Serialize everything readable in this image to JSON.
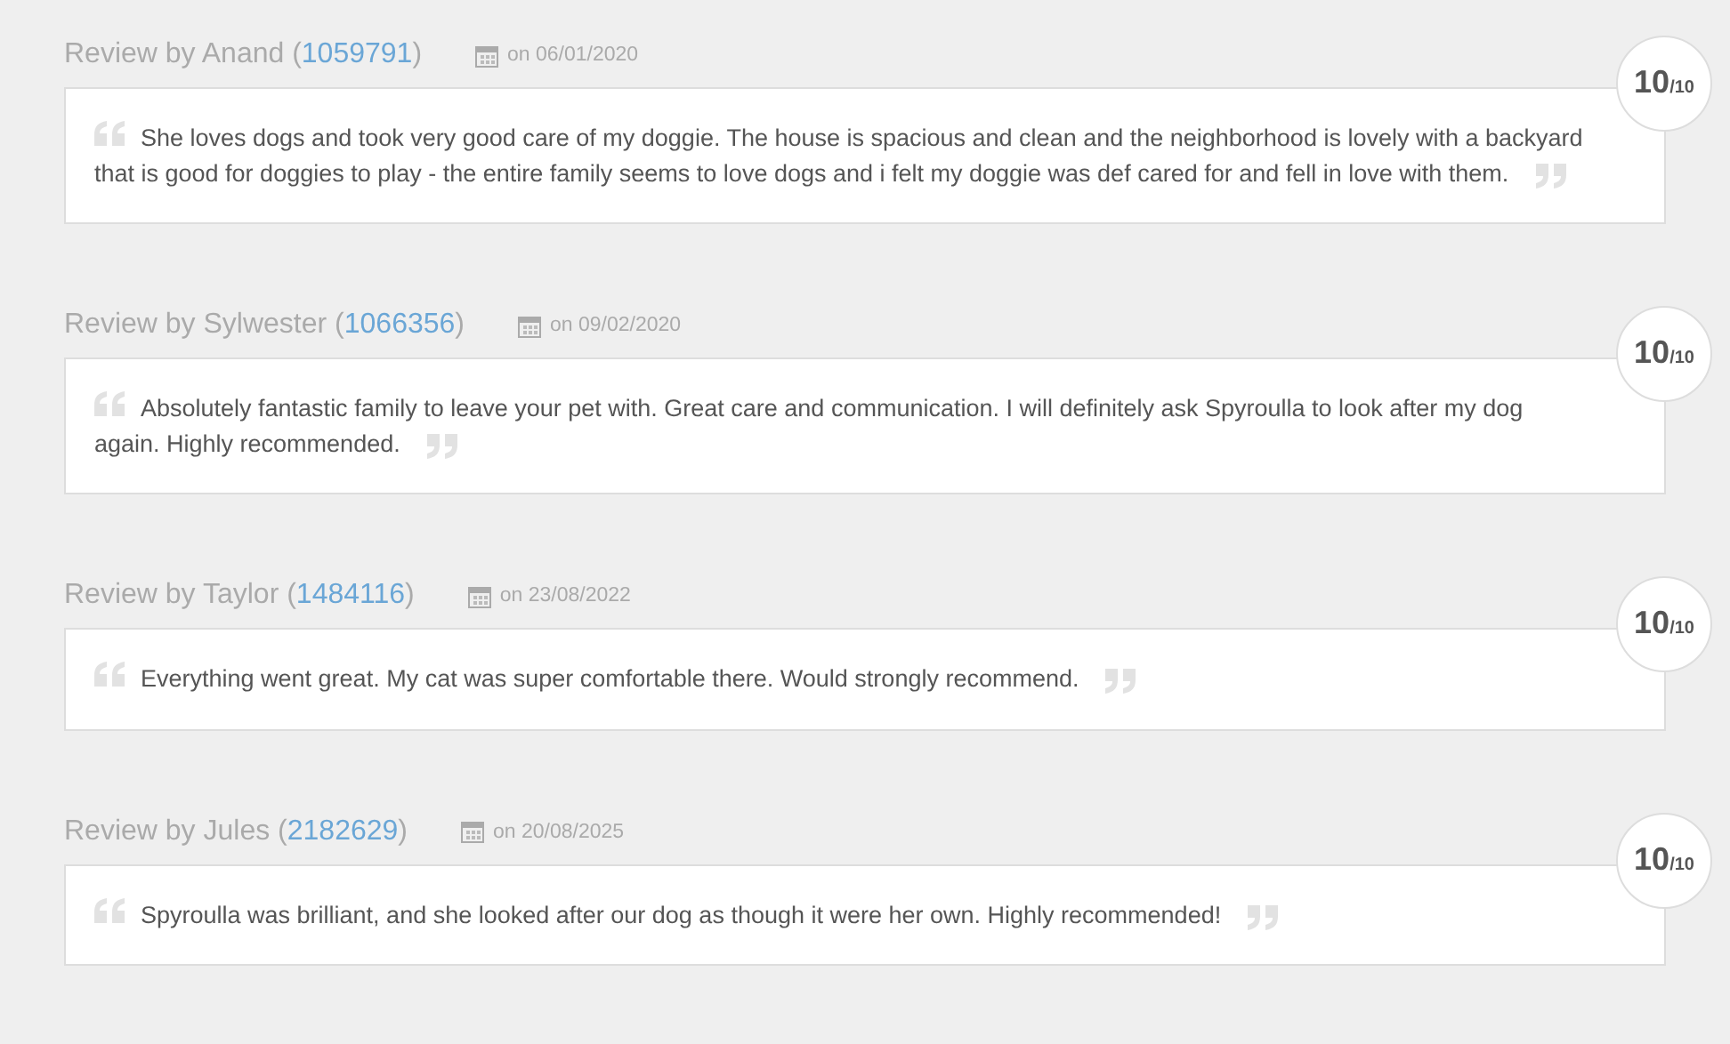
{
  "reviews": [
    {
      "prefix": "Review by Anand (",
      "id": "1059791",
      "suffix": ")",
      "date": "on 06/01/2020",
      "score": "10",
      "out_of": "/10",
      "text": "She loves dogs and took very good care of my doggie. The house is spacious and clean and the neighborhood is lovely with a backyard that is good for doggies to play - the entire family seems to love dogs and i felt my doggie was def cared for and fell in love with them."
    },
    {
      "prefix": "Review by Sylwester (",
      "id": "1066356",
      "suffix": ")",
      "date": "on 09/02/2020",
      "score": "10",
      "out_of": "/10",
      "text": "Absolutely fantastic family to leave your pet with. Great care and communication. I will definitely ask Spyroulla to look after my dog again. Highly recommended."
    },
    {
      "prefix": "Review by Taylor (",
      "id": "1484116",
      "suffix": ")",
      "date": "on 23/08/2022",
      "score": "10",
      "out_of": "/10",
      "text": "Everything went great. My cat was super comfortable there. Would strongly recommend."
    },
    {
      "prefix": "Review by Jules (",
      "id": "2182629",
      "suffix": ")",
      "date": "on 20/08/2025",
      "score": "10",
      "out_of": "/10",
      "text": "Spyroulla was brilliant, and she looked after our dog as though it were her own. Highly recommended!"
    }
  ]
}
